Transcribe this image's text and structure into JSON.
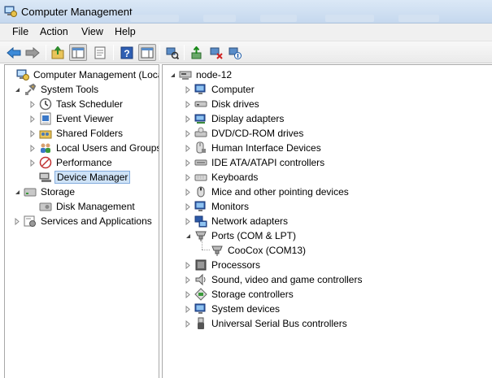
{
  "window": {
    "title": "Computer Management"
  },
  "menu": [
    "File",
    "Action",
    "View",
    "Help"
  ],
  "toolbar": {
    "buttons": [
      "back-icon",
      "forward-icon",
      "up-folder-icon",
      "show-console-tree-icon",
      "properties-icon",
      "help-icon",
      "show-action-pane-icon",
      "scan-hardware-icon",
      "update-driver-icon",
      "disable-device-icon",
      "uninstall-device-icon"
    ]
  },
  "left_tree": [
    {
      "label": "Computer Management (Local",
      "icon": "computer-management-icon",
      "level": 0,
      "expander": "none"
    },
    {
      "label": "System Tools",
      "icon": "system-tools-icon",
      "level": 1,
      "expander": "expanded"
    },
    {
      "label": "Task Scheduler",
      "icon": "clock-icon",
      "level": 2,
      "expander": "collapsed"
    },
    {
      "label": "Event Viewer",
      "icon": "event-viewer-icon",
      "level": 2,
      "expander": "collapsed"
    },
    {
      "label": "Shared Folders",
      "icon": "shared-folders-icon",
      "level": 2,
      "expander": "collapsed"
    },
    {
      "label": "Local Users and Groups",
      "icon": "users-icon",
      "level": 2,
      "expander": "collapsed"
    },
    {
      "label": "Performance",
      "icon": "performance-icon",
      "level": 2,
      "expander": "collapsed"
    },
    {
      "label": "Device Manager",
      "icon": "device-manager-icon",
      "level": 2,
      "expander": "none",
      "selected": true
    },
    {
      "label": "Storage",
      "icon": "storage-icon",
      "level": 1,
      "expander": "expanded"
    },
    {
      "label": "Disk Management",
      "icon": "disk-management-icon",
      "level": 2,
      "expander": "none"
    },
    {
      "label": "Services and Applications",
      "icon": "services-icon",
      "level": 1,
      "expander": "collapsed"
    }
  ],
  "device_tree": {
    "root": {
      "label": "node-12",
      "icon": "computer-icon"
    },
    "categories": [
      {
        "label": "Computer",
        "icon": "monitor-icon",
        "expanded": false
      },
      {
        "label": "Disk drives",
        "icon": "disk-drive-icon",
        "expanded": false
      },
      {
        "label": "Display adapters",
        "icon": "display-adapter-icon",
        "expanded": false
      },
      {
        "label": "DVD/CD-ROM drives",
        "icon": "dvd-icon",
        "expanded": false
      },
      {
        "label": "Human Interface Devices",
        "icon": "hid-icon",
        "expanded": false
      },
      {
        "label": "IDE ATA/ATAPI controllers",
        "icon": "ide-icon",
        "expanded": false
      },
      {
        "label": "Keyboards",
        "icon": "keyboard-icon",
        "expanded": false
      },
      {
        "label": "Mice and other pointing devices",
        "icon": "mouse-icon",
        "expanded": false
      },
      {
        "label": "Monitors",
        "icon": "monitor-icon",
        "expanded": false
      },
      {
        "label": "Network adapters",
        "icon": "network-icon",
        "expanded": false
      },
      {
        "label": "Ports (COM & LPT)",
        "icon": "port-icon",
        "expanded": true,
        "children": [
          {
            "label": "CooCox (COM13)",
            "icon": "port-icon"
          }
        ]
      },
      {
        "label": "Processors",
        "icon": "processor-icon",
        "expanded": false
      },
      {
        "label": "Sound, video and game controllers",
        "icon": "speaker-icon",
        "expanded": false
      },
      {
        "label": "Storage controllers",
        "icon": "storage-controller-icon",
        "expanded": false
      },
      {
        "label": "System devices",
        "icon": "monitor-icon",
        "expanded": false
      },
      {
        "label": "Universal Serial Bus controllers",
        "icon": "usb-icon",
        "expanded": false
      }
    ]
  },
  "colors": {
    "selection": "#cfe3f7",
    "selection_border": "#84acdd",
    "title_bar": "#c5d8ee"
  }
}
